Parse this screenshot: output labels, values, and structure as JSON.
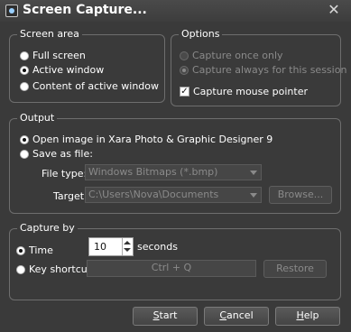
{
  "window": {
    "title": "Screen Capture...",
    "close_glyph": "✕"
  },
  "screen_area": {
    "label": "Screen area",
    "options": [
      "Full screen",
      "Active window",
      "Content of active window"
    ],
    "selected": "Active window"
  },
  "options": {
    "label": "Options",
    "capture_once": "Capture once only",
    "capture_always": "Capture always for this session",
    "capture_mouse_pointer": "Capture mouse pointer",
    "capture_mouse_pointer_checked": true
  },
  "output": {
    "label": "Output",
    "open_image": "Open image in Xara Photo & Graphic Designer 9",
    "save_as_file": "Save as file:",
    "file_type_label": "File type:",
    "file_type_value": "Windows Bitmaps (*.bmp)",
    "target_label": "Target",
    "target_value": "C:\\Users\\Nova\\Documents",
    "browse": "Browse..."
  },
  "capture_by": {
    "label": "Capture by",
    "time": "Time",
    "time_value": "10",
    "seconds": "seconds",
    "key_shortcut": "Key shortcut",
    "shortcut_value": "Ctrl + Q",
    "restore": "Restore"
  },
  "buttons": {
    "start_first": "S",
    "start_rest": "tart",
    "cancel_first": "C",
    "cancel_rest": "ancel",
    "help_first": "H",
    "help_rest": "elp"
  }
}
